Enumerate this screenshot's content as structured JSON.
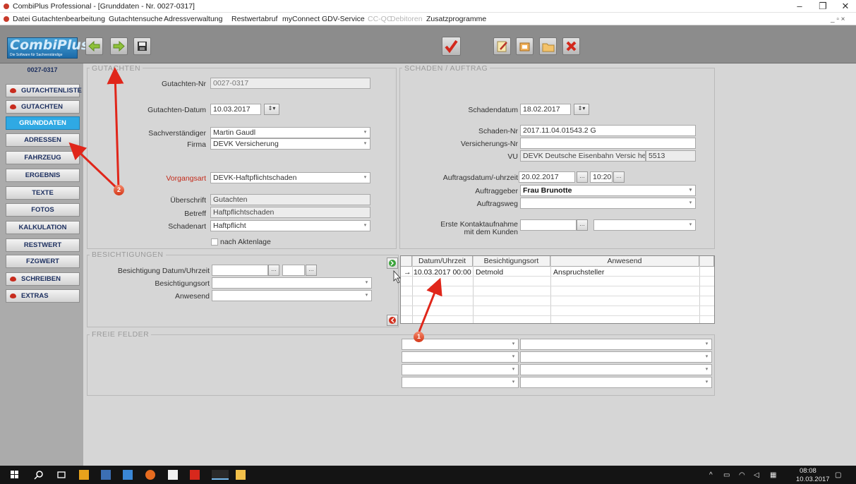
{
  "window": {
    "title": "CombiPlus Professional - [Grunddaten - Nr. 0027-0317]",
    "minimize": "–",
    "maximize": "❐",
    "close": "✕"
  },
  "menu": [
    "Datei",
    "Gutachtenbearbeitung",
    "Gutachtensuche",
    "Adressverwaltung",
    "Restwertabruf",
    "myConnect",
    "GDV-Service",
    "CC-QC",
    "Debitoren",
    "Zusatzprogramme"
  ],
  "menu_disabled": [
    "CC-QC",
    "Debitoren"
  ],
  "mdi_controls": "_ ▫ ×",
  "toolbar": {
    "back_icon": "green-left-arrow-icon",
    "forward_icon": "green-right-arrow-icon",
    "save_icon": "floppy-disk-icon",
    "confirm_icon": "red-check-icon",
    "edit_icon": "pencil-notebook-icon",
    "copy_icon": "copy-window-icon",
    "folder_icon": "folder-icon",
    "delete_icon": "red-x-icon"
  },
  "logo": {
    "text": "CombiPlus",
    "tagline": "Die Software für Sachverständige",
    "id": "0027-0317"
  },
  "sidebar": [
    "GUTACHTENLISTE",
    "GUTACHTEN",
    "GRUNDDATEN",
    "ADRESSEN",
    "FAHRZEUG",
    "ERGEBNIS",
    "TEXTE",
    "FOTOS",
    "KALKULATION",
    "RESTWERT",
    "FZGWERT",
    "SCHREIBEN",
    "EXTRAS"
  ],
  "sidebar_selected": "GRUNDDATEN",
  "gutachten": {
    "group_title": "GUTACHTEN",
    "nr_label": "Gutachten-Nr",
    "nr_value": "0027-0317",
    "datum_label": "Gutachten-Datum",
    "datum_value": "10.03.2017",
    "sv_label": "Sachverständiger",
    "sv_value": "Martin Gaudl",
    "firma_label": "Firma",
    "firma_value": "DEVK Versicherung",
    "vorgangsart_label": "Vorgangsart",
    "vorgangsart_value": "DEVK-Haftpflichtschaden",
    "ueberschrift_label": "Überschrift",
    "ueberschrift_value": "Gutachten",
    "betreff_label": "Betreff",
    "betreff_value": "Haftpflichtschaden",
    "schadenart_label": "Schadenart",
    "schadenart_value": "Haftpflicht",
    "aktenlage_label": "nach Aktenlage"
  },
  "schaden": {
    "group_title": "SCHADEN / AUFTRAG",
    "datum_label": "Schadendatum",
    "datum_value": "18.02.2017",
    "nr_label": "Schaden-Nr",
    "nr_value": "2017.11.04.01543.2 G",
    "vers_label": "Versicherungs-Nr",
    "vers_value": "",
    "vu_label": "VU",
    "vu_value": "DEVK Deutsche Eisenbahn Versic herung",
    "vu_code": "5513",
    "auftrag_label": "Auftragsdatum/-uhrzeit",
    "auftrag_date": "20.02.2017",
    "auftrag_time": "10:20",
    "auftraggeber_label": "Auftraggeber",
    "auftraggeber_value": "Frau Brunotte",
    "auftragsweg_label": "Auftragsweg",
    "auftragsweg_value": "",
    "kontakt_label1": "Erste Kontaktaufnahme",
    "kontakt_label2": "mit dem Kunden"
  },
  "besichtigungen": {
    "group_title": "BESICHTIGUNGEN",
    "datum_label": "Besichtigung Datum/Uhrzeit",
    "ort_label": "Besichtigungsort",
    "anwesend_label": "Anwesend",
    "grid_headers": [
      "Datum/Uhrzeit",
      "Besichtigungsort",
      "Anwesend"
    ],
    "rows": [
      {
        "marker": "→",
        "datum": "10.03.2017 00:00",
        "ort": "Detmold",
        "anwesend": "Anspruchsteller"
      }
    ]
  },
  "freie_felder": {
    "group_title": "FREIE FELDER"
  },
  "annotations": [
    "1",
    "2"
  ],
  "taskbar": {
    "time": "08:08",
    "date": "10.03.2017"
  }
}
